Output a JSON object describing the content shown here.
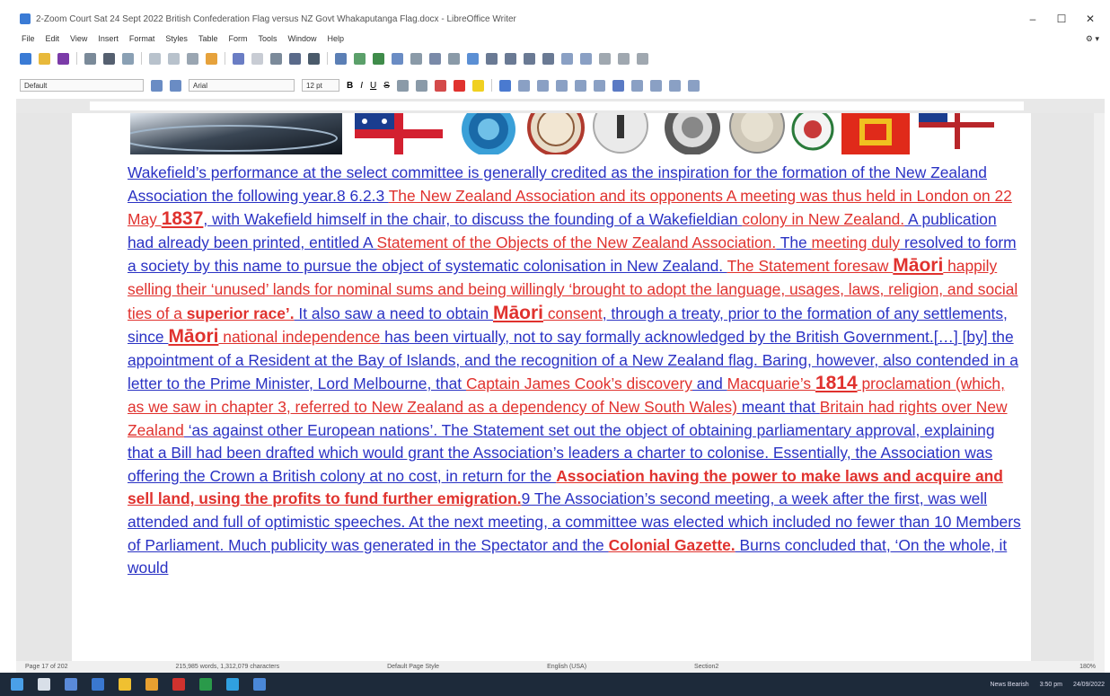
{
  "window": {
    "title": "2-Zoom Court Sat 24 Sept 2022 British Confederation Flag versus NZ Govt Whakaputanga Flag.docx - LibreOffice Writer",
    "minimize": "–",
    "maximize": "☐",
    "close": "✕"
  },
  "menu": {
    "items": [
      "File",
      "Edit",
      "View",
      "Insert",
      "Format",
      "Styles",
      "Table",
      "Form",
      "Tools",
      "Window",
      "Help"
    ],
    "gear": "⚙ ▾"
  },
  "toolbar2": {
    "paragraph_style": "Default",
    "font_name": "Arial",
    "font_size": "12 pt",
    "bold": "B",
    "italic": "I",
    "underline": "U",
    "strike": "S"
  },
  "document": {
    "runs": [
      {
        "t": "Wakefield’s performance at the select committee is generally credited as the inspiration for the formation of the New Zealand Association the following year.8 6.2.3 ",
        "s": "b"
      },
      {
        "t": "The New Zealand Association and its opponents A meeting was thus held in London on 22 May ",
        "s": "r"
      },
      {
        "t": "1837",
        "s": "rbig"
      },
      {
        "t": ", with Wakefield himself in the chair, to discuss the founding of a Wakefieldian ",
        "s": "b"
      },
      {
        "t": "colony in New Zealand.",
        "s": "r"
      },
      {
        "t": " A publication had already been printed, entitled A ",
        "s": "b"
      },
      {
        "t": "Statement of the Objects of the New Zealand Association.",
        "s": "r"
      },
      {
        "t": " The ",
        "s": "b"
      },
      {
        "t": "meeting duly",
        "s": "r"
      },
      {
        "t": " resolved to form a society by this name to pursue the object of systematic colonisation in New Zealand. ",
        "s": "b"
      },
      {
        "t": "The Statement foresaw ",
        "s": "r"
      },
      {
        "t": "Māori",
        "s": "rbig"
      },
      {
        "t": " happily selling their ‘unused’ lands for nominal sums and being willingly ‘brought to adopt the language, usages, laws, religion, and social ties of a ",
        "s": "r"
      },
      {
        "t": "superior race’.",
        "s": "rb"
      },
      {
        "t": " It also saw a need to obtain ",
        "s": "b"
      },
      {
        "t": "Māori",
        "s": "rbig"
      },
      {
        "t": " consent",
        "s": "r"
      },
      {
        "t": ", through a treaty, prior to the formation of any settlements, since ",
        "s": "b"
      },
      {
        "t": "Māori",
        "s": "rbig"
      },
      {
        "t": " national independence",
        "s": "r"
      },
      {
        "t": " has been virtually, not to say formally acknowledged by the British Government.",
        "s": "b"
      },
      {
        "t": "[…]",
        "s": "b"
      },
      {
        "t": " [by] the appointment of a Resident at the Bay of Islands, and the recognition of a New Zealand flag. Baring, however, also contended in a letter to the Prime Minister, Lord Melbourne, that ",
        "s": "b"
      },
      {
        "t": "Captain James Cook’s discovery",
        "s": "r"
      },
      {
        "t": " and ",
        "s": "b"
      },
      {
        "t": "Macquarie’s ",
        "s": "r"
      },
      {
        "t": "1814",
        "s": "rbig"
      },
      {
        "t": " proclamation (which, as we saw in chapter 3, referred to New Zealand as a dependency of New South Wales)",
        "s": "r"
      },
      {
        "t": " meant that ",
        "s": "b"
      },
      {
        "t": "Britain had rights over New Zealand",
        "s": "r"
      },
      {
        "t": " ‘as against other European nations’. The Statement set out the object of obtaining parliamentary approval, explaining that a Bill had been drafted which would grant the Association’s leaders a charter to colonise. Essentially, the Association was offering the Crown a British colony at no cost, in return for the ",
        "s": "b"
      },
      {
        "t": "Association having the power to make laws and acquire and sell land, using the profits to fund further emigration.",
        "s": "rb"
      },
      {
        "t": "9 The Association’s second meeting, a week after the first, was well attended and full of optimistic speeches. At the next meeting, a committee was elected which included no fewer than 10 Members of Parliament. Much publicity was generated in the Spectator and the ",
        "s": "b"
      },
      {
        "t": "Colonial Gazette.",
        "s": "rb"
      },
      {
        "t": " Burns concluded that, ‘On the whole, it would",
        "s": "b"
      }
    ]
  },
  "status": {
    "page": "Page 17 of 202",
    "words": "215,985 words, 1,312,079 characters",
    "page_style": "Default Page Style",
    "language": "English (USA)",
    "section": "Section2",
    "zoom": "180%"
  },
  "taskbar": {
    "news": "News Bearish",
    "time": "3:50 pm",
    "date": "24/09/2022"
  }
}
